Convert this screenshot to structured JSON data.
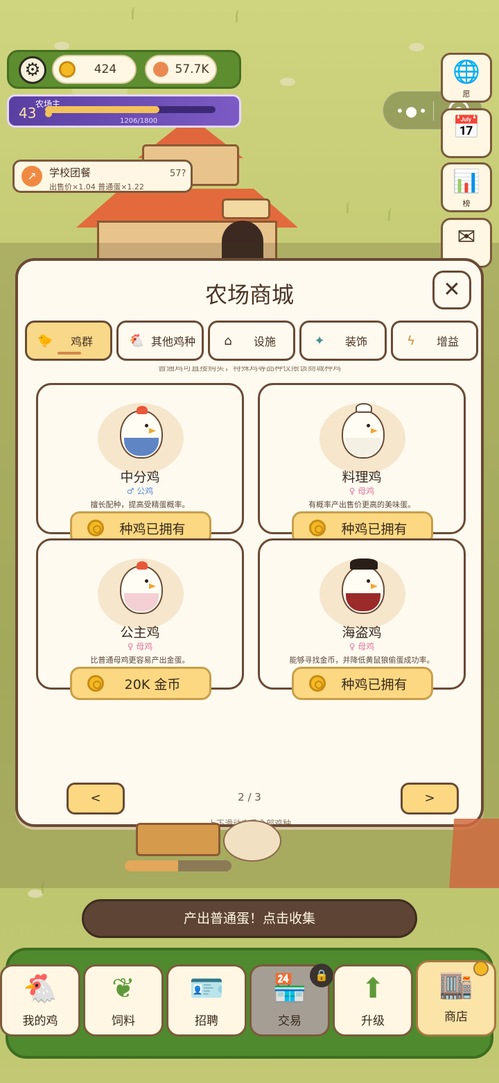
{
  "hud": {
    "coins": "424",
    "eggs": "57.7K",
    "level": "43",
    "title": "农场主",
    "xp_text": "1206/1800",
    "xp_fraction": 0.67
  },
  "event": {
    "title": "学校团餐",
    "subtitle": "出售价×1.04 普通蛋×1.22",
    "count": "57?"
  },
  "side_buttons": [
    {
      "icon": "globe-icon",
      "label": "愿"
    },
    {
      "icon": "calendar-check-icon",
      "label": ""
    },
    {
      "icon": "bar-chart-icon",
      "label": "榜"
    },
    {
      "icon": "mail-icon",
      "label": ""
    }
  ],
  "shop": {
    "title": "农场商城",
    "tabs": [
      {
        "label": "鸡群",
        "icon": "chick-icon",
        "active": true
      },
      {
        "label": "其他鸡种",
        "icon": "chicken-head-icon",
        "active": false
      },
      {
        "label": "设施",
        "icon": "house-icon",
        "active": false
      },
      {
        "label": "装饰",
        "icon": "sparkle-icon",
        "active": false
      },
      {
        "label": "增益",
        "icon": "lightning-icon",
        "active": false
      }
    ],
    "hint_top": "普通鸡可直接购买，特殊鸡等品种仅限该商城种鸡",
    "cards": [
      {
        "name": "中分鸡",
        "gender": "♂ 公鸡",
        "gender_color": "#5b8fd6",
        "desc": "擅长配种，提高受精蛋概率。",
        "button": "种鸡已拥有",
        "outfit": "#5f85c4"
      },
      {
        "name": "料理鸡",
        "gender": "♀ 母鸡",
        "gender_color": "#e07aa0",
        "desc": "有概率产出售价更高的美味蛋。",
        "button": "种鸡已拥有",
        "outfit": "#ffffff"
      },
      {
        "name": "公主鸡",
        "gender": "♀ 母鸡",
        "gender_color": "#e07aa0",
        "desc": "比普通母鸡更容易产出金蛋。",
        "button": "20K 金币",
        "outfit": "#f4cfd4"
      },
      {
        "name": "海盗鸡",
        "gender": "♀ 母鸡",
        "gender_color": "#e07aa0",
        "desc": "能够寻找金币，并降低黄鼠狼偷蛋成功率。",
        "button": "种鸡已拥有",
        "outfit": "#9b2a2a"
      }
    ],
    "prev": "<",
    "next": ">",
    "page": "2 / 3",
    "scroll_hint": "上下滑动查看全部鸡种"
  },
  "production_fraction": 0.5,
  "collect_toast": "产出普通蛋！点击收集",
  "nav": [
    {
      "label": "我的鸡",
      "icon": "chicken-icon"
    },
    {
      "label": "饲料",
      "icon": "leaf-icon"
    },
    {
      "label": "招聘",
      "icon": "id-badge-icon"
    },
    {
      "label": "交易",
      "icon": "market-stall-icon",
      "locked": true
    },
    {
      "label": "升级",
      "icon": "up-arrow-icon"
    },
    {
      "label": "商店",
      "icon": "shop-icon",
      "current": true
    }
  ]
}
